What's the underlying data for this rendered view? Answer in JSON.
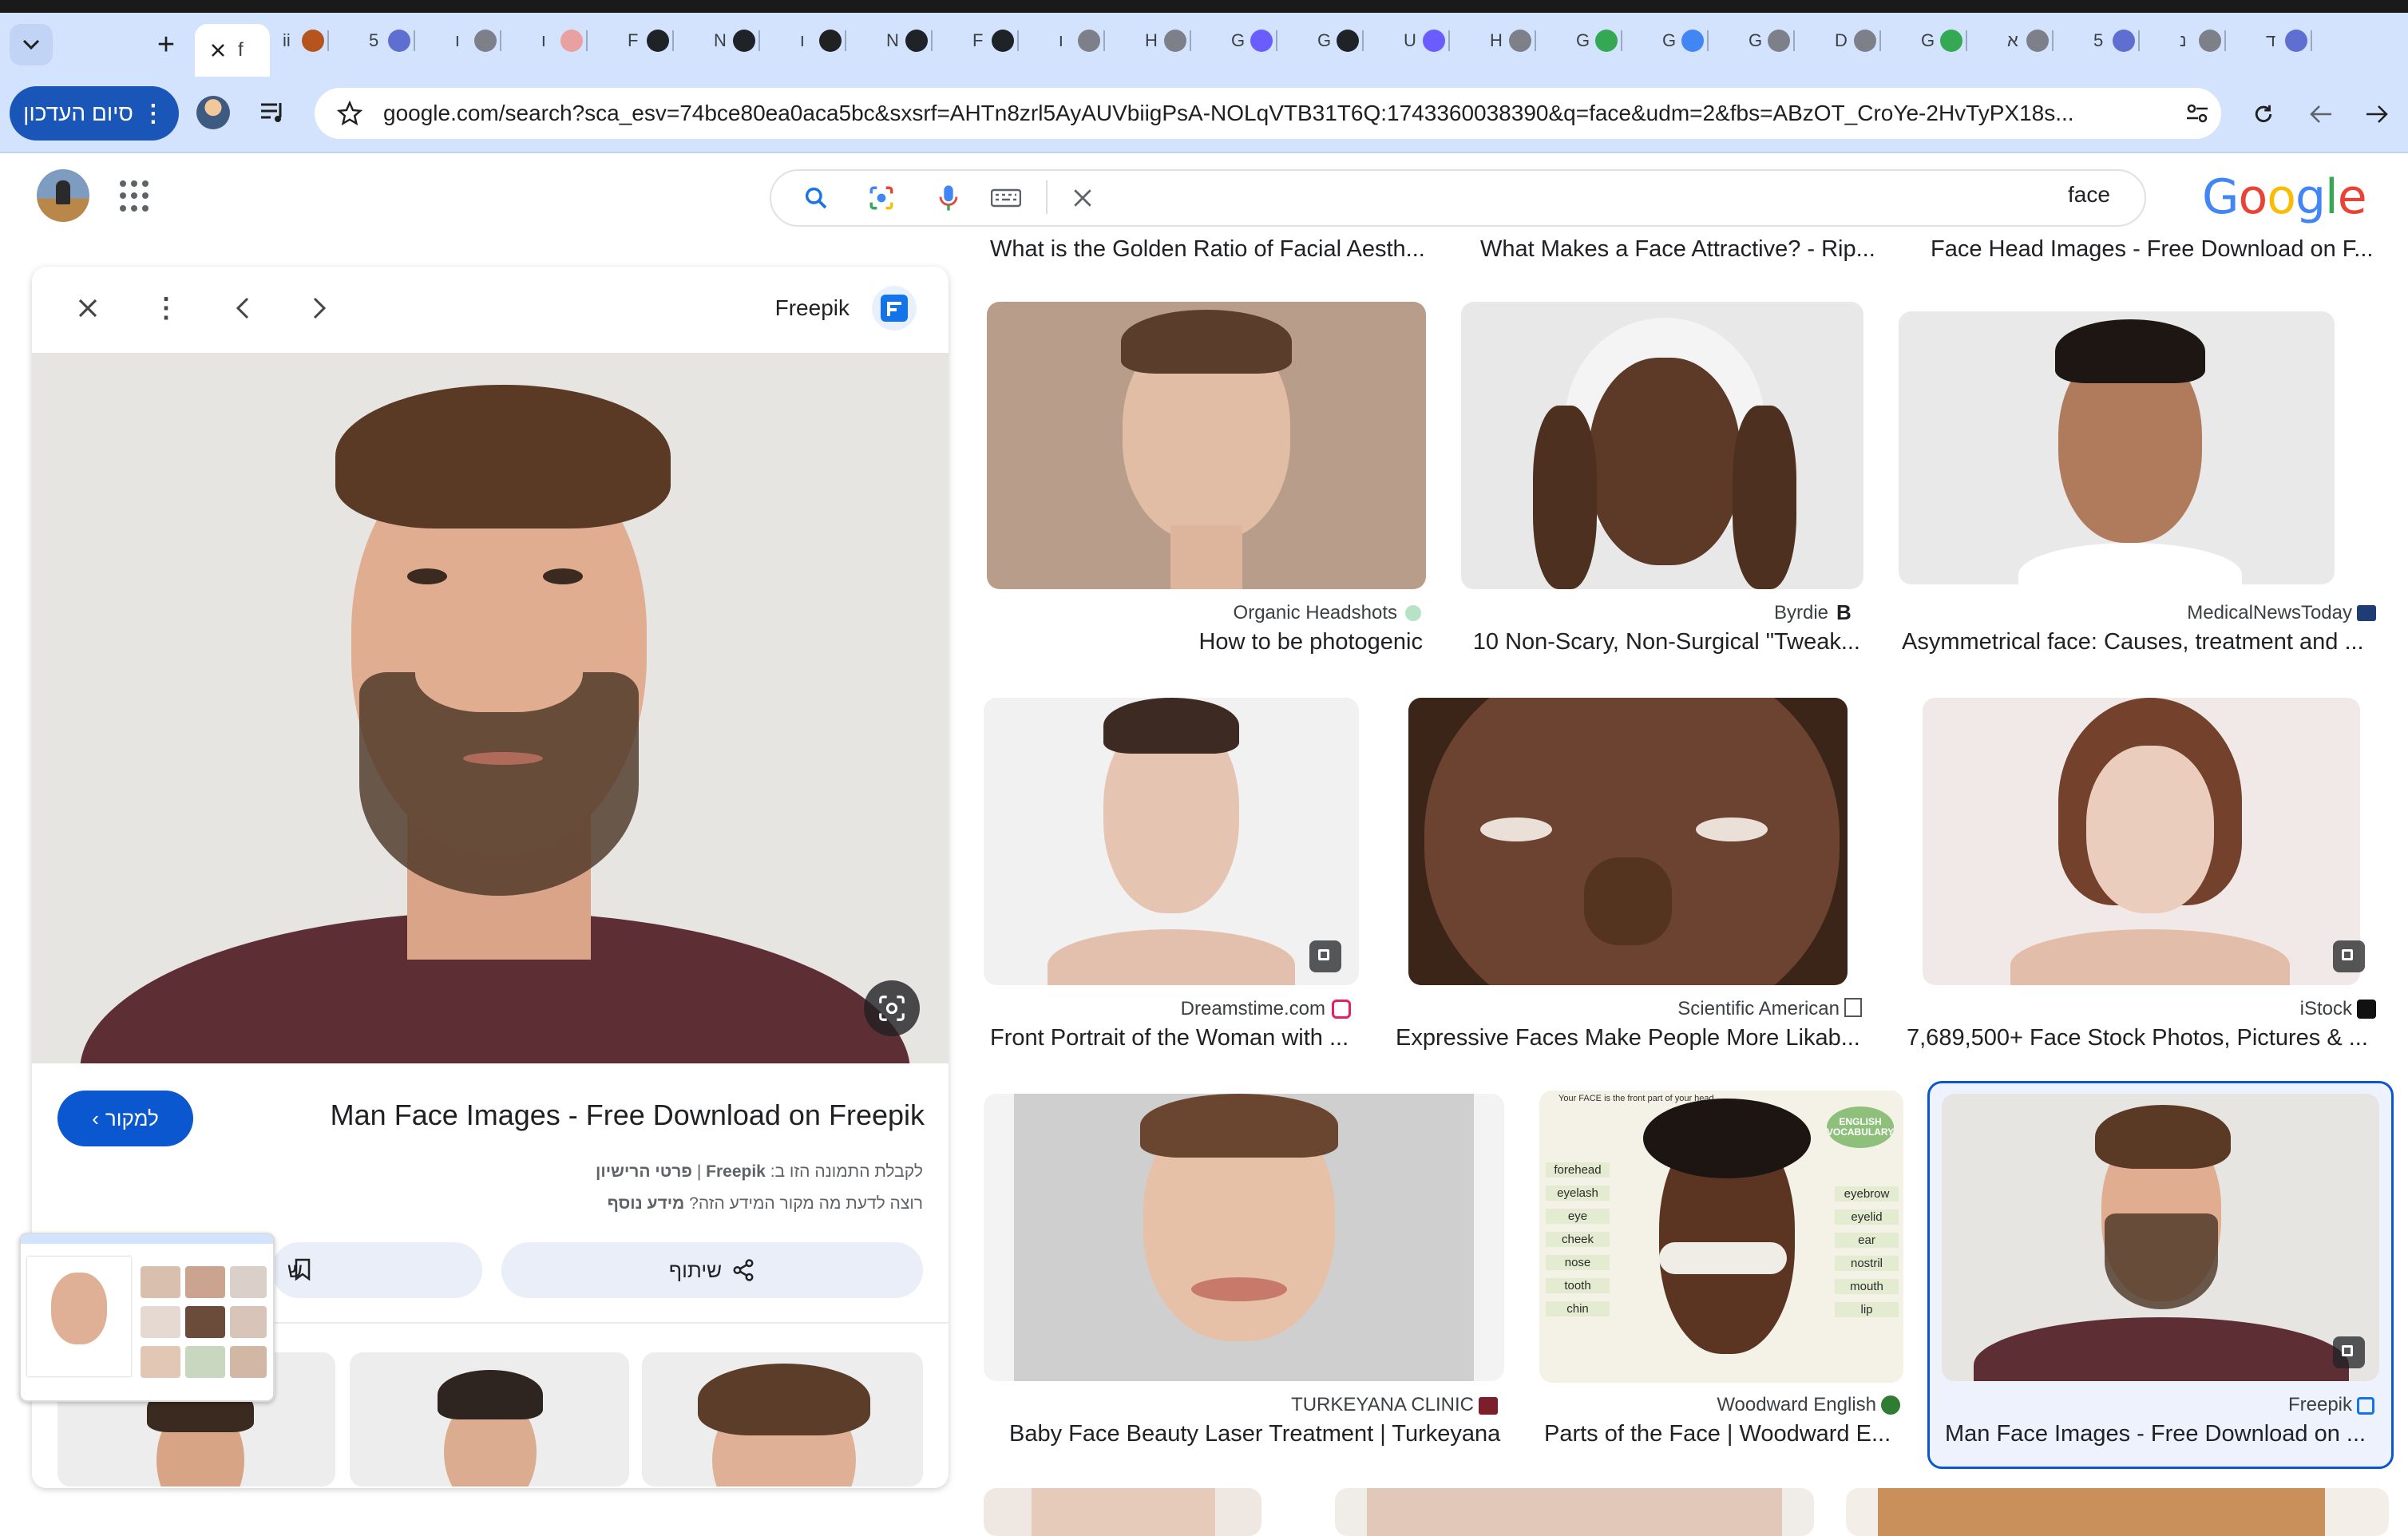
{
  "browser": {
    "tabs": [
      {
        "letter": "f",
        "icon": "close-icon"
      },
      {
        "letter": "ii",
        "icon": "app-favicon"
      },
      {
        "letter": "5",
        "icon": "bot-favicon"
      },
      {
        "letter": "ו",
        "icon": "globe-favicon"
      },
      {
        "letter": "ו",
        "icon": "image-favicon"
      },
      {
        "letter": "F",
        "icon": "github-favicon"
      },
      {
        "letter": "N",
        "icon": "github-favicon"
      },
      {
        "letter": "ו",
        "icon": "openai-favicon"
      },
      {
        "letter": "N",
        "icon": "github-favicon"
      },
      {
        "letter": "F",
        "icon": "github-favicon"
      },
      {
        "letter": "ו",
        "icon": "globe-favicon"
      },
      {
        "letter": "H",
        "icon": "globe-favicon"
      },
      {
        "letter": "G",
        "icon": "ai-favicon"
      },
      {
        "letter": "G",
        "icon": "github-favicon"
      },
      {
        "letter": "U",
        "icon": "ai-favicon"
      },
      {
        "letter": "H",
        "icon": "globe-favicon"
      },
      {
        "letter": "G",
        "icon": "maps-favicon"
      },
      {
        "letter": "G",
        "icon": "translate-favicon"
      },
      {
        "letter": "G",
        "icon": "globe-favicon"
      },
      {
        "letter": "D",
        "icon": "globe-favicon"
      },
      {
        "letter": "G",
        "icon": "maps-favicon"
      },
      {
        "letter": "א",
        "icon": "globe-favicon"
      },
      {
        "letter": "5",
        "icon": "bot-favicon"
      },
      {
        "letter": "נ",
        "icon": "globe-favicon"
      },
      {
        "letter": "ד",
        "icon": "bot-favicon"
      }
    ],
    "new_tab": "+",
    "stop_sync_label": "סיום העדכון",
    "url": "google.com/search?sca_esv=74bce80ea0aca5bc&sxsrf=AHTn8zrl5AyAUVbiigPsA-NOLqVTB31T6Q:1743360038390&q=face&udm=2&fbs=ABzOT_CroYe-2HvTyPX18s..."
  },
  "google": {
    "query": "face",
    "logo": "Google"
  },
  "panel": {
    "source_name": "Freepik",
    "title": "Man Face Images - Free Download on Freepik",
    "visit_label": "למקור",
    "license_line": {
      "prefix": "לקבלת התמונה הזו ב:",
      "source": "Freepik",
      "sep": "|",
      "link": "פרטי הרישיון"
    },
    "more_line": {
      "prefix": "רוצה לדעת מה מקור המידע הזה?",
      "link": "מידע נוסף"
    },
    "save_label": "ש",
    "share_label": "שיתוף"
  },
  "grid": {
    "top_captions": [
      "What is the Golden Ratio of Facial Aesth...",
      "What Makes a Face Attractive? - Rip...",
      "Face Head Images - Free Download on F..."
    ],
    "rows": [
      [
        {
          "source": "Organic Headshots",
          "title": "How to be photogenic"
        },
        {
          "source": "Byrdie",
          "title": "10 Non-Scary, Non-Surgical \"Tweak..."
        },
        {
          "source": "MedicalNewsToday",
          "title": "Asymmetrical face: Causes, treatment and ..."
        }
      ],
      [
        {
          "source": "Dreamstime.com",
          "title": "Front Portrait of the Woman with ..."
        },
        {
          "source": "Scientific American",
          "title": "Expressive Faces Make People More Likab..."
        },
        {
          "source": "iStock",
          "title": "7,689,500+ Face Stock Photos, Pictures & ..."
        }
      ],
      [
        {
          "source": "TURKEYANA CLINIC",
          "title": "Baby Face Beauty Laser Treatment | Turkeyana"
        },
        {
          "source": "Woodward English",
          "title": "Parts of the Face | Woodward E..."
        },
        {
          "source": "Freepik",
          "title": "Man Face Images - Free Download on ..."
        }
      ]
    ],
    "diagram_labels": {
      "header": "Your FACE is the front part of your head.",
      "badge": "ENGLISH VOCABULARY",
      "left": [
        "forehead",
        "eyelash",
        "eye",
        "cheek",
        "nose",
        "tooth",
        "chin"
      ],
      "right": [
        "eyebrow",
        "eyelid",
        "ear",
        "nostril",
        "mouth",
        "lip"
      ]
    }
  },
  "colors": {
    "tabbar": "#d3e3fd",
    "accent": "#0b57d0",
    "selected_border": "#0b57d0"
  }
}
